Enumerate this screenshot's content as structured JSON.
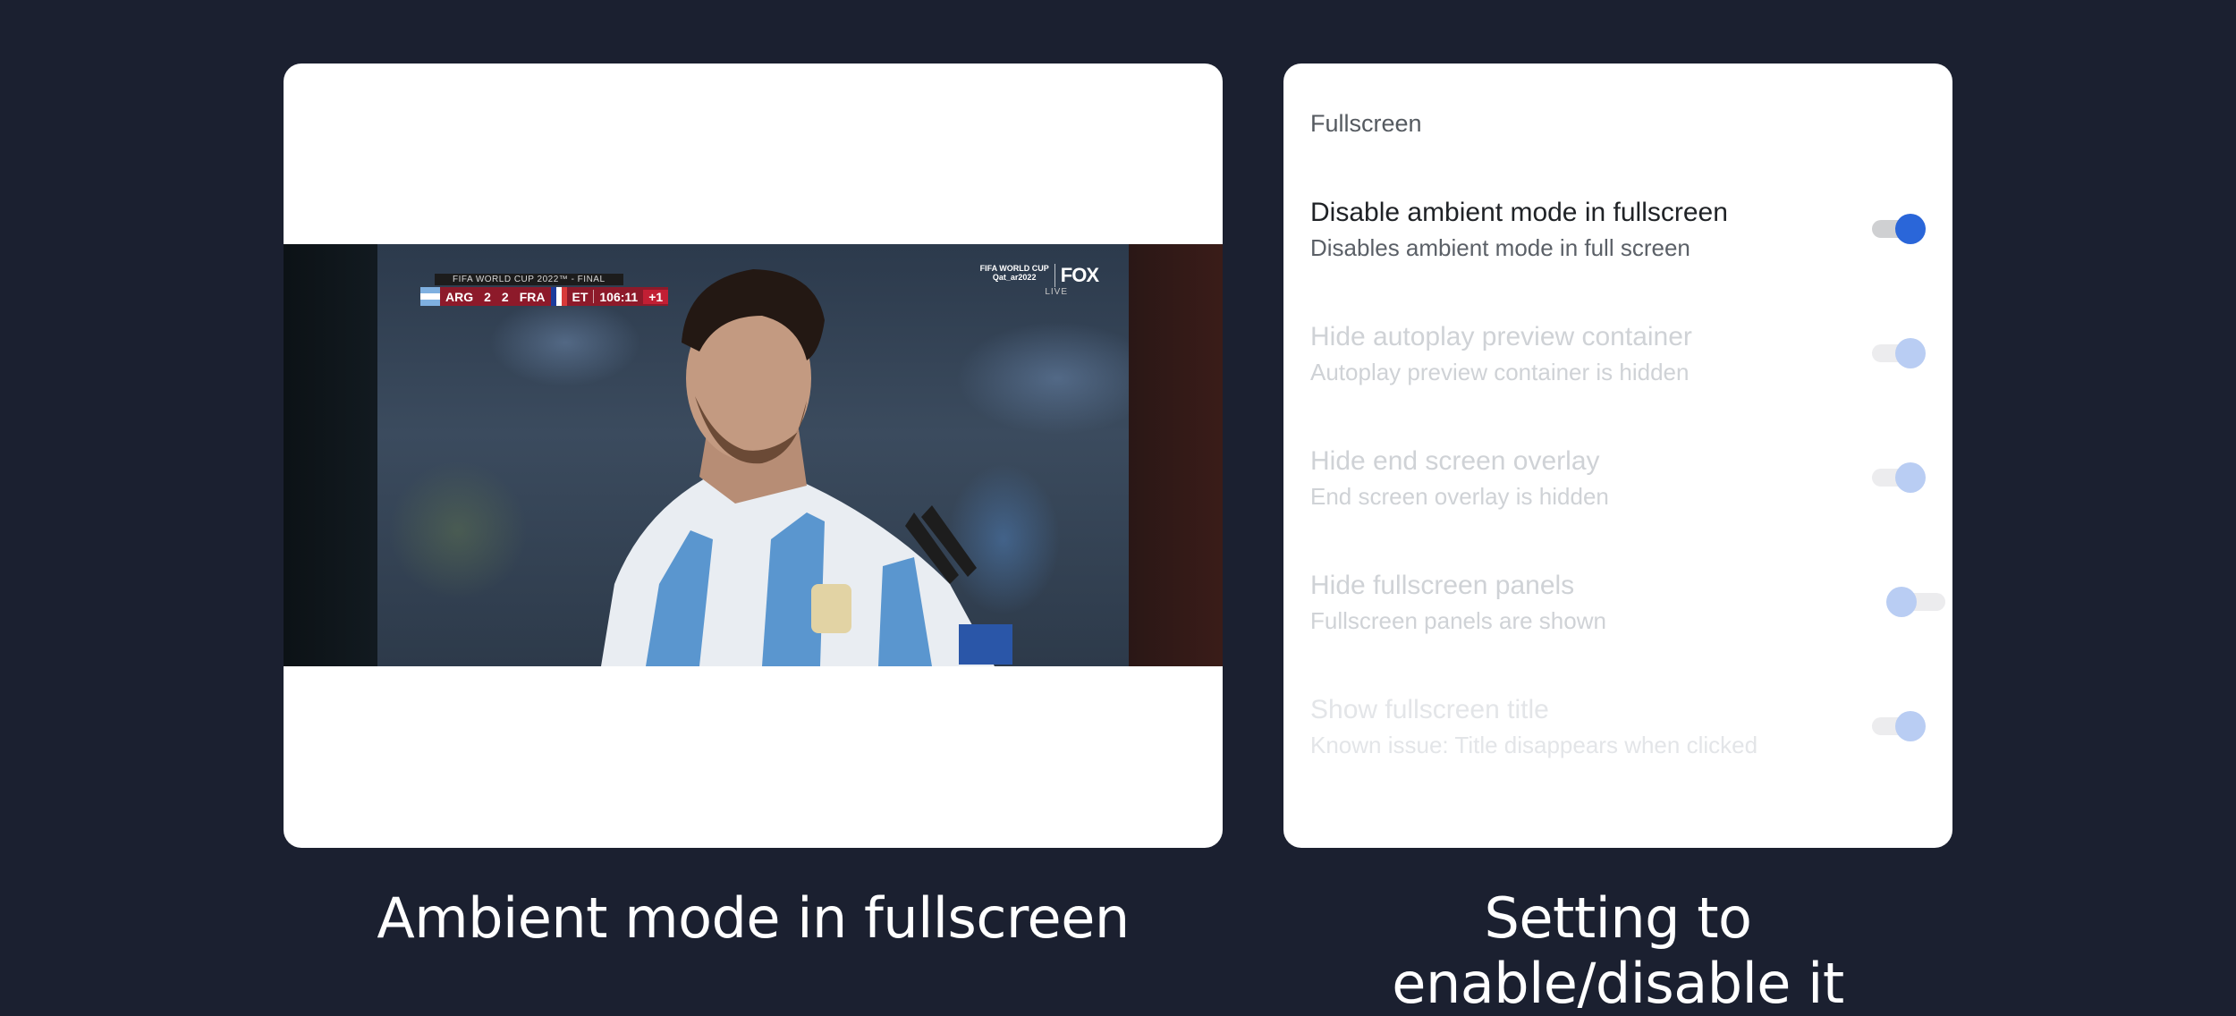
{
  "left_panel": {
    "scoreboard": {
      "competition": "FIFA WORLD CUP 2022™ - FINAL",
      "home_team": "ARG",
      "home_score": "2",
      "away_score": "2",
      "away_team": "FRA",
      "period": "ET",
      "clock": "106:11",
      "added_time": "+1"
    },
    "broadcaster": {
      "event_logo_line1": "FIFA WORLD CUP",
      "event_logo_line2": "Qat_ar2022",
      "network": "FOX",
      "live_label": "LIVE"
    },
    "caption": "Ambient mode in fullscreen"
  },
  "right_panel": {
    "section_title": "Fullscreen",
    "settings": [
      {
        "label": "Disable ambient mode in fullscreen",
        "description": "Disables ambient mode in full screen",
        "enabled": true,
        "state": "active"
      },
      {
        "label": "Hide autoplay preview container",
        "description": "Autoplay preview container is hidden",
        "enabled": true,
        "state": "disabled"
      },
      {
        "label": "Hide end screen overlay",
        "description": "End screen overlay is hidden",
        "enabled": true,
        "state": "disabled"
      },
      {
        "label": "Hide fullscreen panels",
        "description": "Fullscreen panels are shown",
        "enabled": false,
        "state": "disabled"
      },
      {
        "label": "Show fullscreen title",
        "description": "Known issue: Title disappears when clicked",
        "enabled": true,
        "state": "disabled"
      }
    ],
    "caption": "Setting to enable/disable it"
  },
  "colors": {
    "background": "#1b2030",
    "card": "#ffffff",
    "toggle_accent": "#2a66d9",
    "toggle_accent_faded": "#b9cdf3"
  }
}
